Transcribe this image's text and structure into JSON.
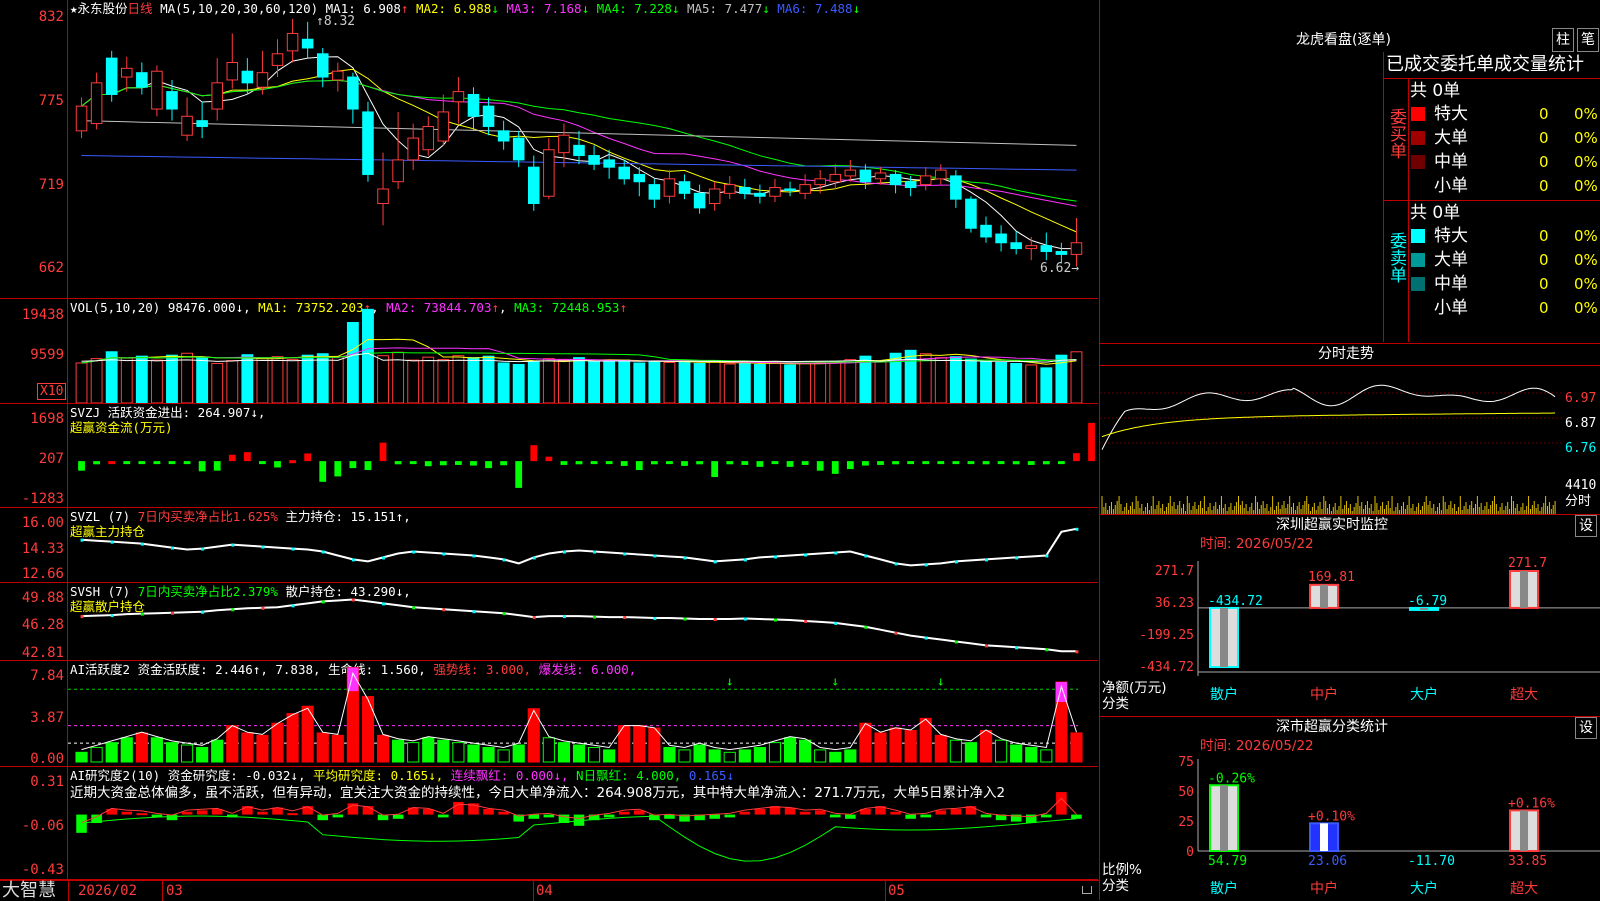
{
  "stock": {
    "title_prefix": "★永东股份",
    "period": "日线",
    "ma_params": "MA(5,10,20,30,60,120)",
    "ma_values": [
      {
        "label": "MA1:",
        "value": "6.908",
        "arrow": "↑",
        "color": "#ffffff"
      },
      {
        "label": "MA2:",
        "value": "6.988",
        "arrow": "↓",
        "color": "#ffff00"
      },
      {
        "label": "MA3:",
        "value": "7.168",
        "arrow": "↓",
        "color": "#ff33ff"
      },
      {
        "label": "MA4:",
        "value": "7.228",
        "arrow": "↓",
        "color": "#00ff00"
      },
      {
        "label": "MA5:",
        "value": "7.477",
        "arrow": "↓",
        "color": "#c0c0c0"
      },
      {
        "label": "MA6:",
        "value": "7.488",
        "arrow": "↓",
        "color": "#3b5bff"
      }
    ],
    "high_mark": "8.32",
    "low_mark": "6.62→",
    "price_ticks": [
      "832",
      "775",
      "719",
      "662"
    ]
  },
  "volume": {
    "header": "VOL(5,10,20)",
    "value": "98476.000",
    "value_arrow": "↓",
    "ma1": "MA1: 73752.203",
    "ma1_arrow": "↑",
    "ma2": "MA2: 73844.703",
    "ma2_arrow": "↑",
    "ma3": "MA3: 72448.953",
    "ma3_arrow": "↑",
    "ticks": [
      "19438",
      "9599"
    ],
    "unit": "X10"
  },
  "svzj": {
    "line1": "SVZJ  活跃资金进出: 264.907↓,",
    "line2": "超赢资金流(万元)",
    "ticks": [
      "1698",
      "207",
      "-1283"
    ]
  },
  "svzl": {
    "name": "SVZL (7)",
    "ratio": "7日内买卖净占比1.625%",
    "hold": "主力持仓: 15.151↑,",
    "line2": "超赢主力持仓",
    "ticks": [
      "16.00",
      "14.33",
      "12.66"
    ]
  },
  "svsh": {
    "name": "SVSH (7)",
    "ratio": "7日内买卖净占比2.379%",
    "hold": "散户持仓: 43.290↓,",
    "line2": "超赢散户持仓",
    "ticks": [
      "49.88",
      "46.28",
      "42.81"
    ]
  },
  "ai_active": {
    "name": "AI活跃度2",
    "a": "资金活跃度: 2.446↑, 7.838,",
    "b": "生命线: 1.560,",
    "c": "强势线: 3.000,",
    "d": "爆发线: 6.000,",
    "ticks": [
      "7.84",
      "3.87",
      "0.00"
    ]
  },
  "ai_research": {
    "name": "AI研究度2(10)",
    "a": "资金研究度: -0.032↓,",
    "b": "平均研究度: 0.165↓,",
    "c": "连续飘红: 0.000↓,",
    "d": "N日飘红: 4.000,",
    "e": "0.165↓",
    "commentary": "近期大资金总体偏多，虽不活跃，但有异动，宜关注大资金的持续性，今日大单净流入：264.908万元，其中特大单净流入：271.7万元，大单5日累计净入2",
    "ticks": [
      "0.31",
      "-0.06",
      "-0.43"
    ]
  },
  "footer": {
    "logo": "大智慧",
    "dates": [
      "2026/02",
      "03",
      "04",
      "05"
    ]
  },
  "right": {
    "dragon_title": "龙虎看盘(逐单)",
    "btn_zhu": "柱",
    "btn_bi": "笔",
    "table_title": "已成交委托单成交量统计",
    "buy_label": "委买单",
    "sell_label": "委卖单",
    "buy_total": "共 0单",
    "sell_total": "共 0单",
    "buy_rows": [
      {
        "name": "特大",
        "val": "0",
        "pct": "0%",
        "color": "#ff0000"
      },
      {
        "name": "大单",
        "val": "0",
        "pct": "0%",
        "color": "#a00000"
      },
      {
        "name": "中单",
        "val": "0",
        "pct": "0%",
        "color": "#700000"
      },
      {
        "name": "小单",
        "val": "0",
        "pct": "0%",
        "color": "#000000"
      }
    ],
    "sell_rows": [
      {
        "name": "特大",
        "val": "0",
        "pct": "0%",
        "color": "#00ffff"
      },
      {
        "name": "大单",
        "val": "0",
        "pct": "0%",
        "color": "#009999"
      },
      {
        "name": "中单",
        "val": "0",
        "pct": "0%",
        "color": "#007070"
      },
      {
        "name": "小单",
        "val": "0",
        "pct": "0%",
        "color": "#000000"
      }
    ],
    "intraday_title": "分时走势",
    "intraday_ticks": [
      "6.97",
      "6.87",
      "6.76"
    ],
    "intraday_vol": "4410",
    "intraday_vol_unit": "分时",
    "sz_title": "深圳超赢实时监控",
    "sz_btn": "设",
    "sz_time": "时间: 2026/05/22",
    "sz_ticks": [
      "271.7",
      "36.23",
      "-199.25",
      "-434.72"
    ],
    "sz_bars": [
      {
        "cat": "散户",
        "value": -434.72,
        "label": "-434.72",
        "color": "#00ffff"
      },
      {
        "cat": "中户",
        "value": 169.81,
        "label": "169.81",
        "color": "#ff3b3b"
      },
      {
        "cat": "大户",
        "value": -6.79,
        "label": "-6.79",
        "color": "#00ffff"
      },
      {
        "cat": "超大",
        "value": 271.7,
        "label": "271.7",
        "color": "#ff3b3b"
      }
    ],
    "sz_ylabel": "净额(万元)",
    "sz_xlabel": "分类",
    "sz_cats": [
      "散户",
      "中户",
      "大户",
      "超大"
    ],
    "cls_title": "深市超赢分类统计",
    "cls_btn": "设",
    "cls_time": "时间: 2026/05/22",
    "cls_ticks": [
      "75",
      "50",
      "25",
      "0"
    ],
    "cls_bars": [
      {
        "cat": "散户",
        "pct": 54.79,
        "top": "-0.26%",
        "bottom": "54.79",
        "color": "#00ff00",
        "bcolor": "#00ff00"
      },
      {
        "cat": "中户",
        "pct": 23.06,
        "top": "+0.10%",
        "bottom": "23.06",
        "color": "#ff3b3b",
        "bcolor": "#3b5bff"
      },
      {
        "cat": "大户",
        "pct": 0,
        "top": "",
        "bottom": "-11.70",
        "color": "#ff3b3b",
        "bcolor": "#00ffff"
      },
      {
        "cat": "超大",
        "pct": 33.85,
        "top": "+0.16%",
        "bottom": "33.85",
        "color": "#ff3b3b",
        "bcolor": "#ff3b3b"
      }
    ],
    "cls_ylabel": "比例%",
    "cls_xlabel": "分类",
    "cls_cats": [
      "散户",
      "中户",
      "大户",
      "超大"
    ]
  },
  "chart_data": [
    {
      "type": "candlestick",
      "title": "永东股份 日线",
      "ylim": [
        6.4,
        8.45
      ],
      "high": 8.32,
      "low": 6.62,
      "candles": [
        [
          7.55,
          7.72,
          7.78,
          7.5
        ],
        [
          7.6,
          7.88,
          7.95,
          7.56
        ],
        [
          8.05,
          7.8,
          8.1,
          7.75
        ],
        [
          7.92,
          7.98,
          8.06,
          7.82
        ],
        [
          7.95,
          7.85,
          8.02,
          7.8
        ],
        [
          7.7,
          7.96,
          8.0,
          7.65
        ],
        [
          7.82,
          7.7,
          7.9,
          7.62
        ],
        [
          7.52,
          7.65,
          7.78,
          7.48
        ],
        [
          7.62,
          7.58,
          7.75,
          7.5
        ],
        [
          7.7,
          7.88,
          8.05,
          7.62
        ],
        [
          7.9,
          8.02,
          8.22,
          7.84
        ],
        [
          7.96,
          7.88,
          8.05,
          7.8
        ],
        [
          7.85,
          7.95,
          8.1,
          7.8
        ],
        [
          8.0,
          8.08,
          8.18,
          7.92
        ],
        [
          8.1,
          8.22,
          8.32,
          8.02
        ],
        [
          8.18,
          8.12,
          8.3,
          8.05
        ],
        [
          8.08,
          7.92,
          8.12,
          7.85
        ],
        [
          7.9,
          7.96,
          8.02,
          7.82
        ],
        [
          7.92,
          7.7,
          7.95,
          7.6
        ],
        [
          7.68,
          7.25,
          7.75,
          7.2
        ],
        [
          7.05,
          7.15,
          7.4,
          6.9
        ],
        [
          7.2,
          7.35,
          7.68,
          7.15
        ],
        [
          7.35,
          7.5,
          7.6,
          7.28
        ],
        [
          7.42,
          7.58,
          7.65,
          7.38
        ],
        [
          7.48,
          7.68,
          7.8,
          7.45
        ],
        [
          7.75,
          7.82,
          7.92,
          7.6
        ],
        [
          7.8,
          7.65,
          7.85,
          7.55
        ],
        [
          7.72,
          7.58,
          7.78,
          7.52
        ],
        [
          7.55,
          7.48,
          7.62,
          7.42
        ],
        [
          7.5,
          7.35,
          7.55,
          7.3
        ],
        [
          7.3,
          7.05,
          7.38,
          7.0
        ],
        [
          7.1,
          7.42,
          7.5,
          7.08
        ],
        [
          7.4,
          7.52,
          7.6,
          7.3
        ],
        [
          7.45,
          7.38,
          7.55,
          7.32
        ],
        [
          7.38,
          7.32,
          7.45,
          7.28
        ],
        [
          7.35,
          7.3,
          7.42,
          7.22
        ],
        [
          7.3,
          7.22,
          7.35,
          7.18
        ],
        [
          7.25,
          7.2,
          7.3,
          7.1
        ],
        [
          7.18,
          7.08,
          7.22,
          7.02
        ],
        [
          7.1,
          7.22,
          7.28,
          7.05
        ],
        [
          7.2,
          7.12,
          7.25,
          7.08
        ],
        [
          7.12,
          7.02,
          7.18,
          6.98
        ],
        [
          7.05,
          7.15,
          7.2,
          7.0
        ],
        [
          7.12,
          7.18,
          7.24,
          7.08
        ],
        [
          7.16,
          7.12,
          7.22,
          7.08
        ],
        [
          7.12,
          7.1,
          7.18,
          7.05
        ],
        [
          7.1,
          7.16,
          7.22,
          7.06
        ],
        [
          7.15,
          7.14,
          7.2,
          7.1
        ],
        [
          7.12,
          7.18,
          7.25,
          7.08
        ],
        [
          7.18,
          7.22,
          7.28,
          7.12
        ],
        [
          7.2,
          7.25,
          7.32,
          7.15
        ],
        [
          7.24,
          7.28,
          7.35,
          7.2
        ],
        [
          7.28,
          7.2,
          7.32,
          7.15
        ],
        [
          7.22,
          7.26,
          7.3,
          7.18
        ],
        [
          7.25,
          7.18,
          7.28,
          7.12
        ],
        [
          7.2,
          7.16,
          7.24,
          7.1
        ],
        [
          7.18,
          7.24,
          7.3,
          7.14
        ],
        [
          7.22,
          7.28,
          7.32,
          7.18
        ],
        [
          7.24,
          7.08,
          7.28,
          7.02
        ],
        [
          7.08,
          6.88,
          7.1,
          6.85
        ],
        [
          6.9,
          6.82,
          6.96,
          6.78
        ],
        [
          6.84,
          6.78,
          6.9,
          6.72
        ],
        [
          6.78,
          6.74,
          6.86,
          6.7
        ],
        [
          6.74,
          6.76,
          6.82,
          6.66
        ],
        [
          6.76,
          6.72,
          6.85,
          6.66
        ],
        [
          6.72,
          6.7,
          6.78,
          6.64
        ],
        [
          6.7,
          6.78,
          6.95,
          6.62
        ]
      ]
    },
    {
      "type": "bar",
      "title": "VOL(5,10,20)",
      "ylim": [
        0,
        20500
      ],
      "values": [
        8200,
        9100,
        10500,
        9200,
        9600,
        8800,
        9800,
        10200,
        9300,
        8100,
        8700,
        9900,
        9300,
        9500,
        8900,
        9800,
        10100,
        9500,
        16500,
        19200,
        9700,
        10400,
        8800,
        9400,
        8900,
        9700,
        9300,
        9600,
        8200,
        7900,
        8400,
        9100,
        8800,
        9300,
        8500,
        8700,
        8800,
        8200,
        8600,
        8300,
        8500,
        8100,
        8400,
        8000,
        8200,
        7900,
        8300,
        7800,
        8100,
        8200,
        8500,
        8900,
        9600,
        8400,
        10200,
        10800,
        10100,
        9300,
        9500,
        9000,
        8400,
        8300,
        8100,
        7800,
        7200,
        9800,
        10500
      ]
    },
    {
      "type": "bar",
      "title": "SVZJ 活跃资金进出",
      "ylim": [
        -1283,
        1698
      ],
      "values": [
        -300,
        -100,
        0,
        -50,
        -30,
        -50,
        -80,
        -40,
        -320,
        -300,
        200,
        280,
        -50,
        -200,
        30,
        240,
        -650,
        -480,
        -220,
        -280,
        580,
        -100,
        -80,
        -160,
        -130,
        -120,
        -140,
        -220,
        -130,
        -840,
        500,
        140,
        -120,
        -100,
        -50,
        -80,
        -150,
        -280,
        -100,
        -90,
        -150,
        -100,
        -500,
        -100,
        -120,
        -180,
        -80,
        -180,
        -120,
        -300,
        -400,
        -250,
        -140,
        -120,
        -100,
        -80,
        -60,
        -80,
        -90,
        -60,
        -100,
        -70,
        -100,
        -120,
        -100,
        -80,
        250,
        1200,
        170
      ]
    },
    {
      "type": "line",
      "title": "SVZL 主力持仓",
      "ylim": [
        12.66,
        16.0
      ],
      "values": [
        14.6,
        14.55,
        14.5,
        14.45,
        14.4,
        14.3,
        14.2,
        14.1,
        14.15,
        14.25,
        14.35,
        14.3,
        14.25,
        14.2,
        14.15,
        14.1,
        14.0,
        13.8,
        13.6,
        13.5,
        13.7,
        13.9,
        14.0,
        13.95,
        13.9,
        13.85,
        13.8,
        13.7,
        13.6,
        13.4,
        13.7,
        13.9,
        14.0,
        14.05,
        14.0,
        13.95,
        13.9,
        13.85,
        13.8,
        13.75,
        13.7,
        13.6,
        13.5,
        13.55,
        13.6,
        13.7,
        13.75,
        13.8,
        13.85,
        13.9,
        13.95,
        14.0,
        13.8,
        13.6,
        13.4,
        13.3,
        13.35,
        13.4,
        13.5,
        13.55,
        13.6,
        13.65,
        13.7,
        13.75,
        13.8,
        15.0,
        15.15
      ]
    },
    {
      "type": "line",
      "title": "SVSH 散户持仓",
      "ylim": [
        42.81,
        49.88
      ],
      "values": [
        46.9,
        46.95,
        47.0,
        47.1,
        47.15,
        47.2,
        47.25,
        47.3,
        47.35,
        47.5,
        47.6,
        47.7,
        47.75,
        47.8,
        48.0,
        48.2,
        48.4,
        48.5,
        48.6,
        48.4,
        48.2,
        48.0,
        47.8,
        47.7,
        47.6,
        47.5,
        47.4,
        47.3,
        47.2,
        47.0,
        46.8,
        46.9,
        46.9,
        46.9,
        46.85,
        46.8,
        46.8,
        46.75,
        46.7,
        46.7,
        46.65,
        46.6,
        46.6,
        46.6,
        46.65,
        46.6,
        46.55,
        46.5,
        46.4,
        46.3,
        46.2,
        46.0,
        45.8,
        45.5,
        45.2,
        44.9,
        44.7,
        44.5,
        44.3,
        44.1,
        43.9,
        43.8,
        43.7,
        43.6,
        43.5,
        43.3,
        43.29
      ]
    },
    {
      "type": "bar",
      "title": "AI活跃度2",
      "ylim": [
        0,
        7.84
      ],
      "values": [
        0.8,
        1.2,
        1.6,
        2.0,
        2.4,
        2.0,
        1.6,
        1.4,
        1.2,
        1.8,
        3.0,
        2.4,
        2.2,
        3.2,
        4.0,
        4.6,
        2.4,
        2.2,
        7.8,
        5.4,
        2.2,
        1.8,
        1.6,
        2.0,
        1.8,
        1.6,
        1.4,
        1.2,
        1.0,
        1.4,
        4.4,
        2.0,
        1.6,
        1.4,
        1.2,
        1.0,
        3.0,
        3.0,
        2.8,
        1.2,
        1.0,
        1.4,
        1.0,
        0.8,
        1.0,
        1.2,
        1.6,
        2.0,
        1.8,
        1.0,
        0.8,
        1.0,
        3.2,
        2.4,
        2.8,
        2.6,
        3.6,
        2.2,
        1.8,
        1.6,
        2.6,
        1.8,
        1.4,
        1.2,
        1.0,
        6.6,
        2.4
      ]
    },
    {
      "type": "bar",
      "title": "AI研究度2(10)",
      "ylim": [
        -0.43,
        0.31
      ],
      "values": [
        -0.13,
        -0.06,
        0.04,
        0.02,
        0.01,
        -0.02,
        -0.04,
        0.02,
        0.03,
        0.04,
        -0.02,
        0.06,
        0.02,
        0.05,
        0.01,
        0.06,
        -0.04,
        -0.02,
        0.08,
        0.06,
        -0.04,
        -0.03,
        0.05,
        0.04,
        -0.02,
        0.09,
        0.08,
        0.04,
        0.02,
        -0.05,
        -0.03,
        -0.02,
        -0.06,
        -0.08,
        -0.04,
        -0.02,
        0.02,
        0.03,
        -0.04,
        -0.03,
        -0.05,
        -0.04,
        -0.03,
        -0.02,
        0.02,
        0.04,
        0.06,
        0.05,
        0.02,
        0.03,
        -0.02,
        -0.03,
        0.04,
        0.06,
        0.02,
        -0.03,
        -0.02,
        0.03,
        0.04,
        0.06,
        -0.02,
        -0.04,
        -0.05,
        -0.06,
        -0.02,
        0.16,
        -0.03
      ]
    }
  ]
}
